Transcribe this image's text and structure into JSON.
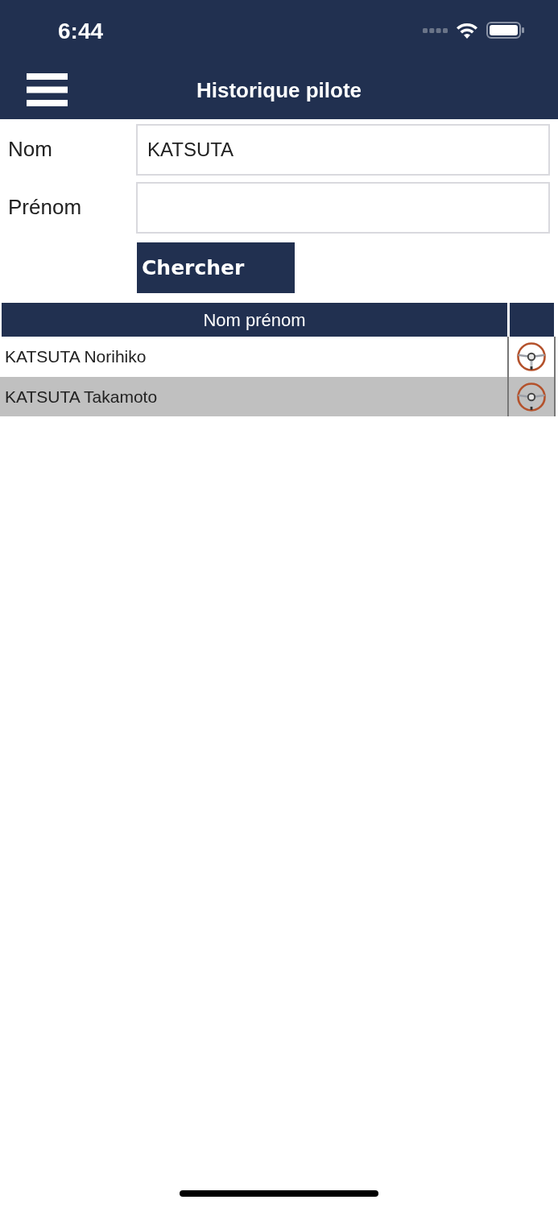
{
  "status_bar": {
    "time": "6:44"
  },
  "header": {
    "title": "Historique pilote"
  },
  "form": {
    "fields": [
      {
        "label": "Nom",
        "value": "KATSUTA"
      },
      {
        "label": "Prénom"
      }
    ],
    "search_button": "Chercher"
  },
  "table": {
    "columns": [
      "Nom prénom"
    ],
    "rows": [
      {
        "name": "KATSUTA Norihiko",
        "selected": false
      },
      {
        "name": "KATSUTA Takamoto",
        "selected": true
      }
    ]
  }
}
